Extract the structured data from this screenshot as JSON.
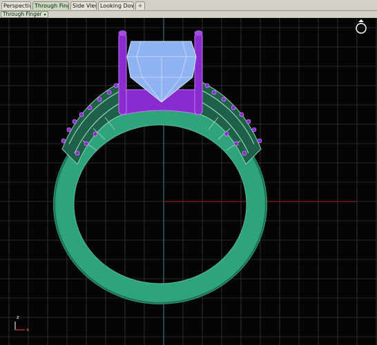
{
  "tabs": [
    {
      "label": "Perspective",
      "active": false
    },
    {
      "label": "Through Finger",
      "active": true
    },
    {
      "label": "Side View",
      "active": false
    },
    {
      "label": "Looking Down",
      "active": false
    }
  ],
  "add_tab_glyph": "+",
  "viewport": {
    "label": "Through Finger",
    "dropdown_glyph": "▾",
    "axis_labels": {
      "x": "x",
      "z": "z"
    },
    "background_color": "#050505",
    "grid_color": "#4a4a4a",
    "axis_x_color": "#8b1a1a",
    "axis_z_color": "#1f8a5a"
  },
  "ring": {
    "band_color": "#2fa37a",
    "stone_color": "#8fb2f0",
    "prong_color": "#8a2bd0",
    "accent_gem_color": "#8a2bd0"
  },
  "icons": {
    "view_ring": "ring-view-icon",
    "axis": "axis-gizmo-icon"
  }
}
